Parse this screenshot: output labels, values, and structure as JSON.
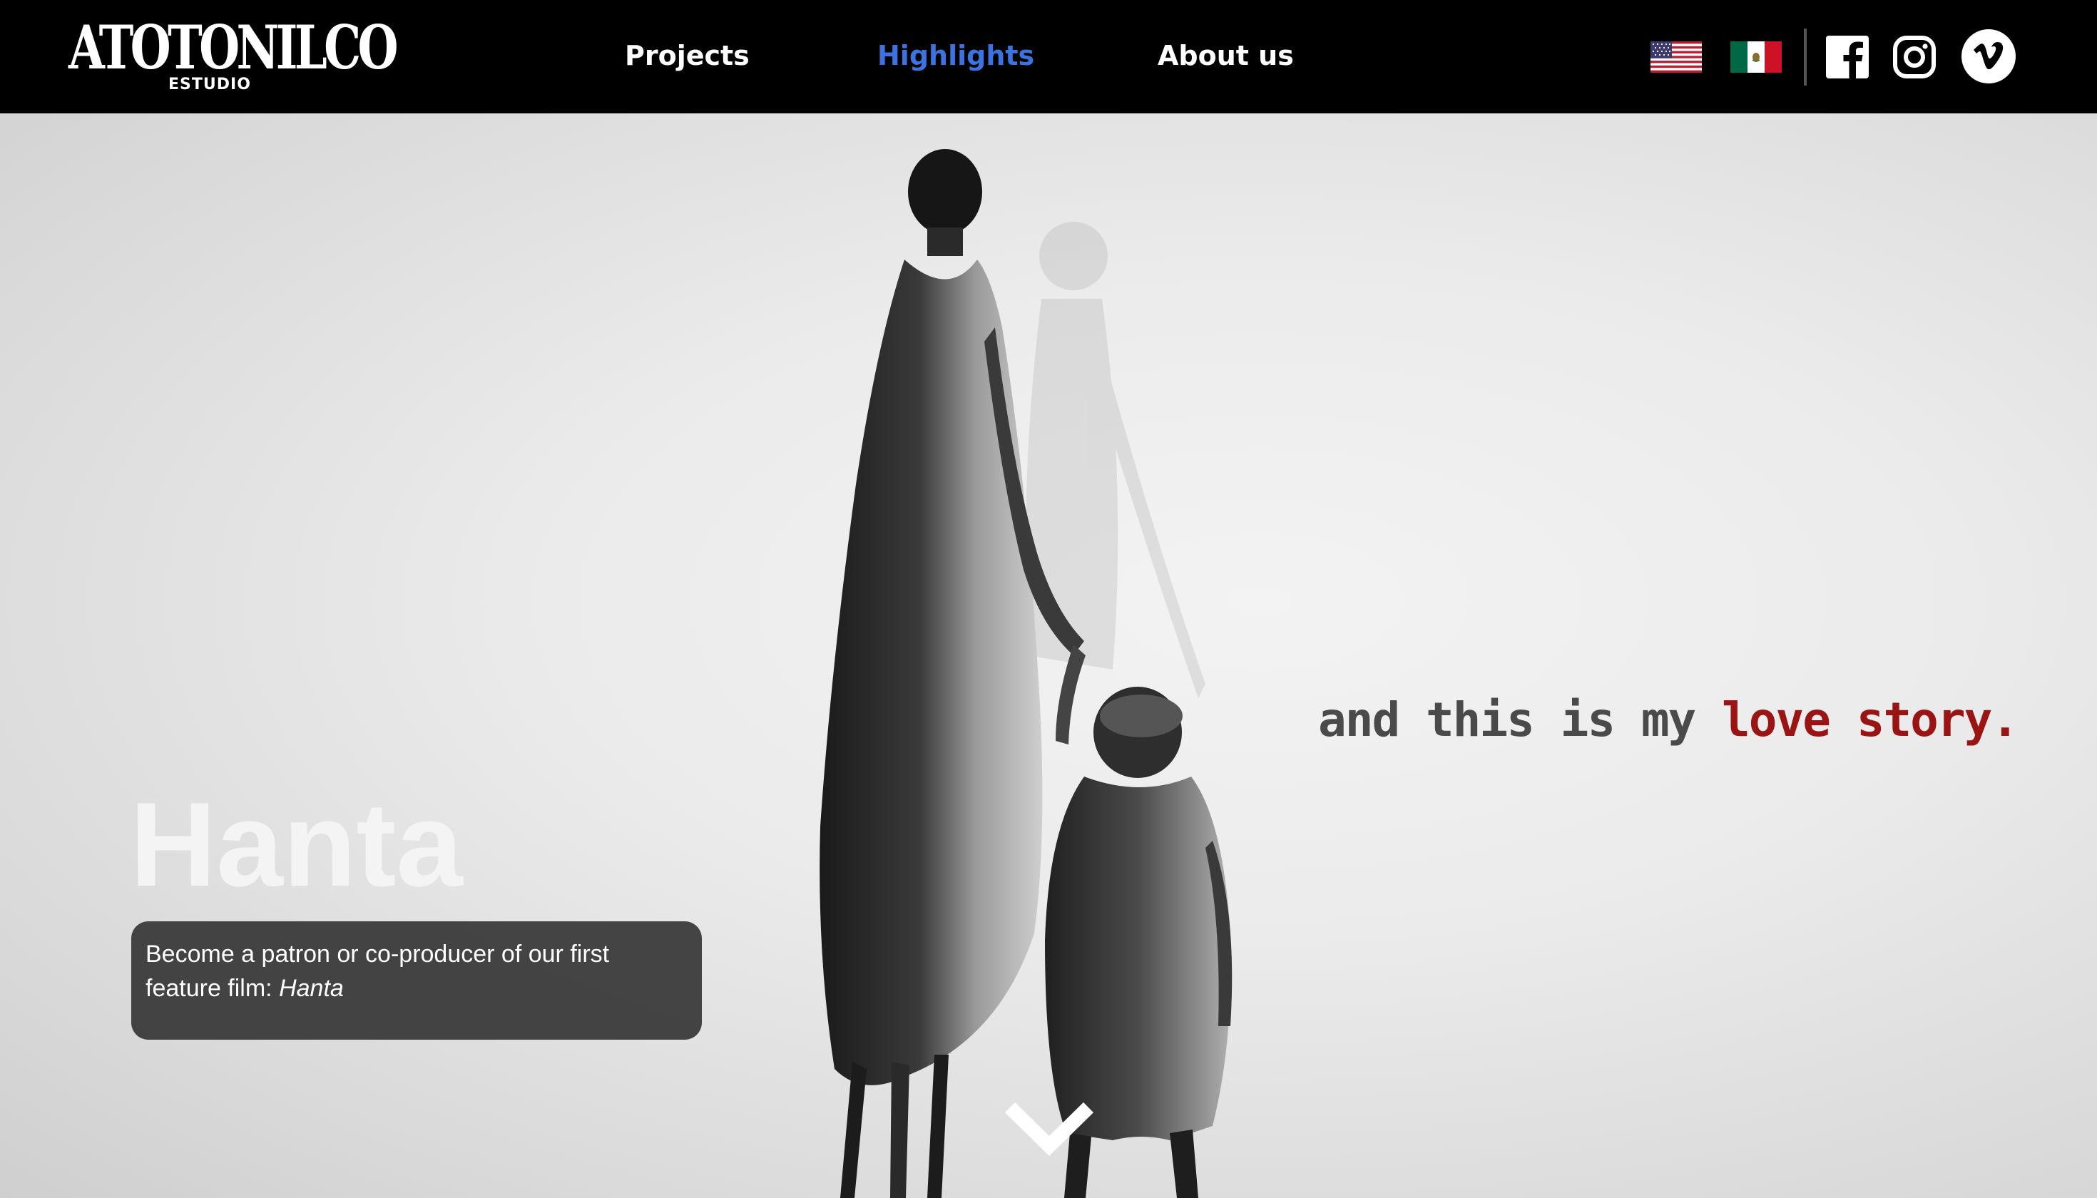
{
  "header": {
    "logo": {
      "name": "ATOTONILCO",
      "sub": "ESTUDIO"
    },
    "nav": [
      {
        "label": "Projects",
        "active": false
      },
      {
        "label": "Highlights",
        "active": true
      },
      {
        "label": "About us",
        "active": false
      }
    ],
    "languages": [
      {
        "icon": "us-flag-icon"
      },
      {
        "icon": "mexico-flag-icon"
      }
    ],
    "social": [
      {
        "icon": "facebook-icon"
      },
      {
        "icon": "instagram-icon"
      },
      {
        "icon": "vimeo-icon"
      }
    ],
    "colors": {
      "background": "#000000",
      "active_link": "#3b74e0",
      "link": "#ffffff"
    }
  },
  "hero": {
    "tagline_part1": "and this is my ",
    "tagline_part2": "love story.",
    "title": "Hanta",
    "cta_text": "Become a patron or co-producer of our first feature film: ",
    "cta_film": "Hanta",
    "scroll_icon": "chevron-down-icon",
    "colors": {
      "tagline": "#4a4a4a",
      "tagline_accent": "#9a1414",
      "cta_background": "#323232"
    }
  }
}
